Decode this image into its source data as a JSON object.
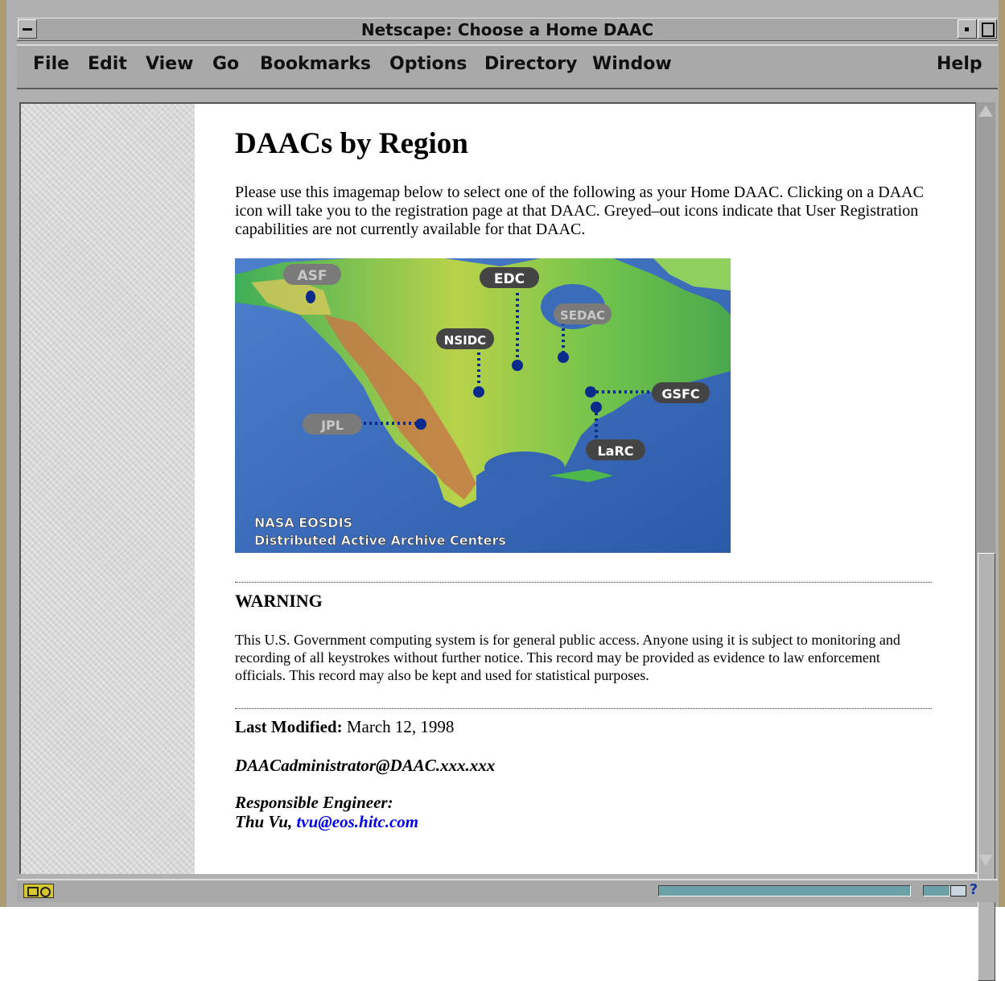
{
  "window": {
    "title": "Netscape: Choose a Home DAAC"
  },
  "menu": {
    "file": "File",
    "edit": "Edit",
    "view": "View",
    "go": "Go",
    "bookmarks": "Bookmarks",
    "options": "Options",
    "directory": "Directory",
    "window": "Window",
    "help": "Help"
  },
  "page": {
    "heading": "DAACs by Region",
    "intro": "Please use this imagemap below to select one of the following as your Home DAAC. Clicking on a DAAC icon will take you to the registration page at that DAAC. Greyed–out icons indicate that User Registration capabilities are not currently available for that DAAC.",
    "map": {
      "labels": {
        "asf": "ASF",
        "edc": "EDC",
        "sedac": "SEDAC",
        "nsidc": "NSIDC",
        "gsfc": "GSFC",
        "jpl": "JPL",
        "larc": "LaRC"
      },
      "caption_line1": "NASA EOSDIS",
      "caption_line2": "Distributed Active Archive Centers",
      "colors": {
        "ocean": "#3a6fbf",
        "land_green": "#4fb84a",
        "land_yellow": "#c8d94a",
        "mountain": "#c47a45",
        "marker": "#0a2a8c",
        "active_label": "#4a4a4a",
        "grey_label": "#7a7a7a"
      }
    },
    "warning_title": "WARNING",
    "warning_text": "This U.S. Government computing system is for general public access. Anyone using it is subject to monitoring and recording of all keystrokes without further notice. This record may be provided as evidence to law enforcement officials. This record may also be kept and used for statistical purposes.",
    "last_modified_label": "Last Modified:",
    "last_modified_value": "March 12, 1998",
    "admin_email": "DAACadministrator@DAAC.xxx.xxx",
    "engineer_label": "Responsible Engineer:",
    "engineer_name": "Thu Vu,",
    "engineer_email": "tvu@eos.hitc.com"
  }
}
